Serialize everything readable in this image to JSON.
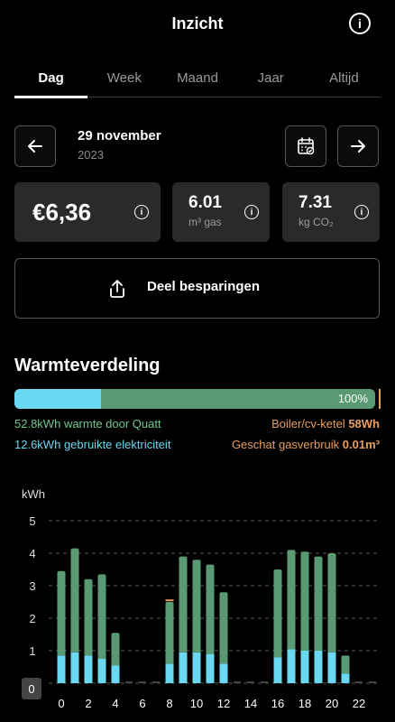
{
  "header": {
    "title": "Inzicht"
  },
  "tabs": [
    {
      "label": "Dag"
    },
    {
      "label": "Week"
    },
    {
      "label": "Maand"
    },
    {
      "label": "Jaar"
    },
    {
      "label": "Altijd"
    }
  ],
  "date": {
    "main": "29 november",
    "year": "2023"
  },
  "stats": {
    "cost": "€6,36",
    "gas_value": "6.01",
    "gas_unit": "m³ gas",
    "co2_value": "7.31",
    "co2_unit": "kg CO₂"
  },
  "share": {
    "label": "Deel besparingen"
  },
  "heat_distribution": {
    "title": "Warmteverdeling",
    "percent_label": "100%",
    "electricity_fraction": 0.24,
    "quatt_value": "52.8kWh",
    "quatt_label": "warmte door Quatt",
    "elec_value": "12.6kWh",
    "elec_label": "gebruikte elektriciteit",
    "boiler_label": "Boiler/cv-ketel",
    "boiler_value": "58Wh",
    "gas_est_label": "Geschat gasverbruik",
    "gas_est_value": "0.01m³"
  },
  "colors": {
    "green": "#5a9a73",
    "cyan": "#6ad8f0",
    "orange": "#e8a060"
  },
  "chart_data": {
    "type": "bar",
    "ylabel": "kWh",
    "ylim": [
      0,
      5
    ],
    "yticks": [
      0,
      1,
      2,
      3,
      4,
      5
    ],
    "xticks": [
      "0",
      "2",
      "4",
      "6",
      "8",
      "10",
      "12",
      "14",
      "16",
      "18",
      "20",
      "22"
    ],
    "x": [
      0,
      1,
      2,
      3,
      4,
      8,
      9,
      10,
      11,
      12,
      16,
      17,
      18,
      19,
      20,
      21
    ],
    "series": [
      {
        "name": "gebruikte elektriciteit",
        "values": [
          0.85,
          0.95,
          0.85,
          0.75,
          0.55,
          0.6,
          0.95,
          0.95,
          0.9,
          0.6,
          0.8,
          1.05,
          1.0,
          1.0,
          0.95,
          0.3
        ]
      },
      {
        "name": "warmte door Quatt",
        "values": [
          2.6,
          3.2,
          2.35,
          2.6,
          1.0,
          1.9,
          2.95,
          2.85,
          2.75,
          2.2,
          2.7,
          3.05,
          3.05,
          2.9,
          3.05,
          0.55
        ]
      },
      {
        "name": "Boiler/cv-ketel",
        "values": [
          0,
          0,
          0,
          0,
          0,
          0.05,
          0,
          0,
          0,
          0,
          0,
          0,
          0,
          0,
          0,
          0
        ]
      }
    ]
  }
}
